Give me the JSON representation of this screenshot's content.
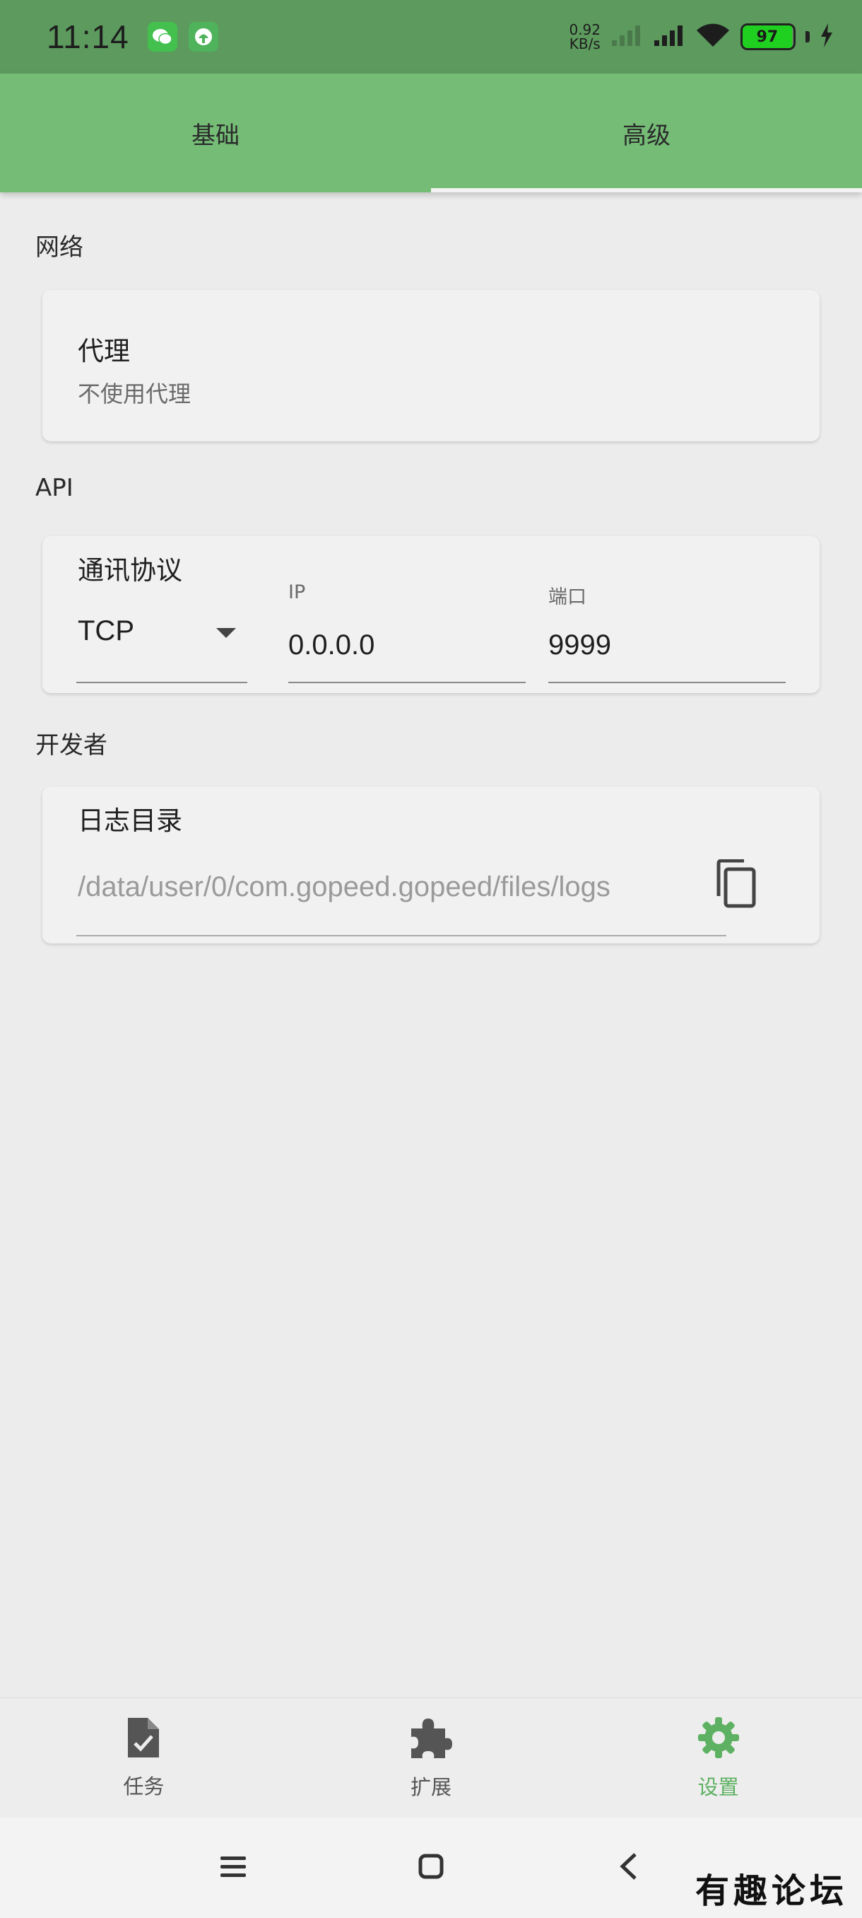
{
  "status_bar": {
    "time": "11:14",
    "net_speed_value": "0.92",
    "net_speed_unit": "KB/s",
    "battery_text": "97"
  },
  "tabs": [
    {
      "label": "基础",
      "active": false
    },
    {
      "label": "高级",
      "active": true
    }
  ],
  "sections": {
    "network": {
      "title": "网络",
      "proxy_label": "代理",
      "proxy_value": "不使用代理"
    },
    "api": {
      "title": "API",
      "protocol_label": "通讯协议",
      "protocol_value": "TCP",
      "ip_caption": "IP",
      "ip_value": "0.0.0.0",
      "port_caption": "端口",
      "port_value": "9999"
    },
    "developer": {
      "title": "开发者",
      "log_dir_label": "日志目录",
      "log_dir_value": "/data/user/0/com.gopeed.gopeed/files/logs"
    }
  },
  "bottom_nav": [
    {
      "label": "任务",
      "icon": "task-file-icon",
      "active": false
    },
    {
      "label": "扩展",
      "icon": "puzzle-icon",
      "active": false
    },
    {
      "label": "设置",
      "icon": "gear-icon",
      "active": true
    }
  ],
  "colors": {
    "status_bar": "#5d9a5e",
    "tab_bar": "#75bd77",
    "accent": "#5eb162",
    "background": "#ececec"
  },
  "watermark": "有趣论坛"
}
